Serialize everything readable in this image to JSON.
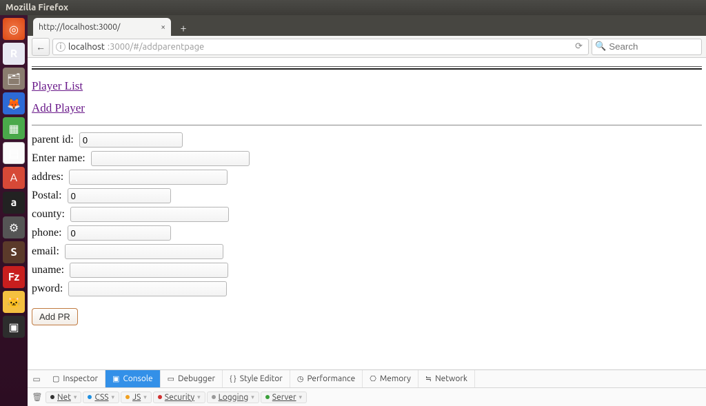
{
  "window": {
    "title": "Mozilla Firefox"
  },
  "tab": {
    "title": "http://localhost:3000/",
    "close": "×"
  },
  "newtab": "+",
  "nav": {
    "back": "←",
    "info": "i",
    "host": "localhost",
    "rest": ":3000/#/addparentpage",
    "refresh": "⟳",
    "search_placeholder": "Search",
    "search_icon": "🔍"
  },
  "page": {
    "links": {
      "player_list": "Player List",
      "add_player": "Add Player"
    },
    "labels": {
      "parent_id": "parent id:",
      "name": "Enter name:",
      "address": "addres:",
      "postal": "Postal:",
      "county": "county:",
      "phone": "phone:",
      "email": "email:",
      "uname": "uname:",
      "pword": "pword:"
    },
    "values": {
      "parent_id": "0",
      "name": "",
      "address": "",
      "postal": "0",
      "county": "",
      "phone": "0",
      "email": "",
      "uname": "",
      "pword": ""
    },
    "add_button": "Add PR"
  },
  "devtools": {
    "tabs": {
      "inspector": "Inspector",
      "console": "Console",
      "debugger": "Debugger",
      "style": "Style Editor",
      "perf": "Performance",
      "memory": "Memory",
      "network": "Network"
    },
    "filters": {
      "net": "Net",
      "css": "CSS",
      "js": "JS",
      "security": "Security",
      "logging": "Logging",
      "server": "Server"
    }
  },
  "launcher_tips": {
    "dash": "Dash",
    "r": "R",
    "files": "Files",
    "ff": "Firefox",
    "lo1": "LibreOffice",
    "lo2": "Document",
    "a": "App",
    "amz": "Amazon",
    "gear": "Settings",
    "s": "Sublime",
    "fz": "FileZilla",
    "cat": "Dev",
    "term": "Terminal"
  }
}
